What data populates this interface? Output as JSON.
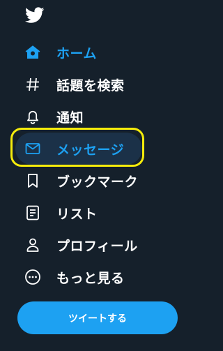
{
  "app": {
    "logo_icon": "twitter-bird-icon",
    "accent_color": "#1da1f2",
    "background_color": "#15202b",
    "annotation_color": "#f5ec0b"
  },
  "nav": {
    "items": [
      {
        "label": "ホーム",
        "icon": "home-icon",
        "active": true
      },
      {
        "label": "話題を検索",
        "icon": "hashtag-icon",
        "active": false
      },
      {
        "label": "通知",
        "icon": "bell-icon",
        "active": false
      },
      {
        "label": "メッセージ",
        "icon": "envelope-icon",
        "active": false,
        "highlighted": true
      },
      {
        "label": "ブックマーク",
        "icon": "bookmark-icon",
        "active": false
      },
      {
        "label": "リスト",
        "icon": "list-icon",
        "active": false
      },
      {
        "label": "プロフィール",
        "icon": "person-icon",
        "active": false
      },
      {
        "label": "もっと見る",
        "icon": "more-circle-icon",
        "active": false
      }
    ]
  },
  "tweet_button": {
    "label": "ツイートする"
  }
}
